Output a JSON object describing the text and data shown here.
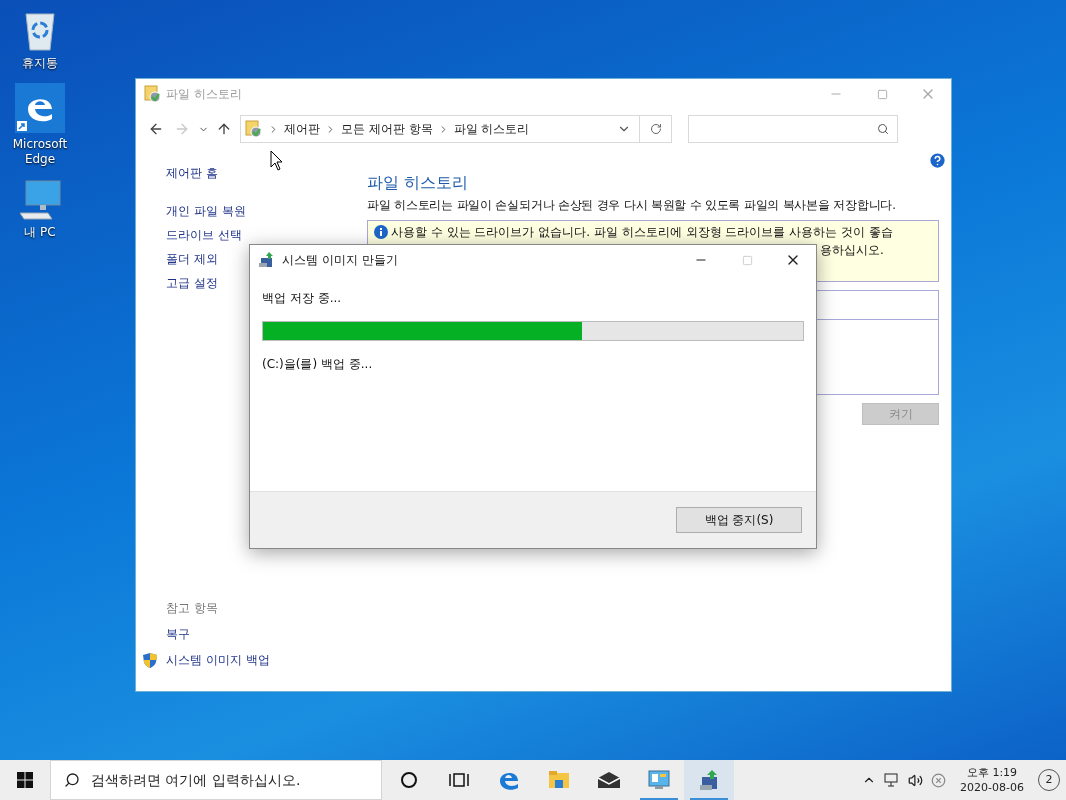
{
  "desktop_icons": [
    {
      "kind": "recycle",
      "label": "휴지통"
    },
    {
      "kind": "edge",
      "label": "Microsoft Edge"
    },
    {
      "kind": "pc",
      "label": "내 PC"
    }
  ],
  "window": {
    "title": "파일 히스토리",
    "nav_buttons": [
      {
        "kind": "back",
        "disabled": false
      },
      {
        "kind": "forward",
        "disabled": true
      },
      {
        "kind": "recent",
        "disabled": false
      },
      {
        "kind": "up",
        "disabled": false
      }
    ],
    "breadcrumb": [
      "제어판",
      "모든 제어판 항목",
      "파일 히스토리"
    ],
    "sidebar": {
      "links": [
        "제어판 홈",
        "개인 파일 복원",
        "드라이브 선택",
        "폴더 제외",
        "고급 설정"
      ],
      "see_also_heading": "참고 항목",
      "see_also": [
        {
          "kind": "plain",
          "label": "복구"
        },
        {
          "kind": "shield",
          "label": "시스템 이미지 백업"
        }
      ]
    },
    "heading": "파일 히스토리",
    "description": "파일 히스토리는 파일이 손실되거나 손상된 경우 다시 복원할 수 있도록 파일의 복사본을 저장합니다.",
    "info_line_1": "사용할 수 있는 드라이브가 없습니다. 파일 히스토리에 외장형 드라이브를 사용하는 것이 좋습",
    "info_line_2_visible": "용하십시오.",
    "turn_on_button": {
      "label": "켜기",
      "disabled": true
    }
  },
  "dialog": {
    "title": "시스템 이미지 만들기",
    "status": "백업 저장 중...",
    "progress": {
      "level": 0.59
    },
    "detail": "(C:)을(를) 백업 중...",
    "stop_button": "백업 중지(S)"
  },
  "taskbar": {
    "search_placeholder": "검색하려면 여기에 입력하십시오.",
    "apps": [
      {
        "kind": "cortana",
        "running": false,
        "selected": false
      },
      {
        "kind": "taskview",
        "running": false,
        "selected": false
      },
      {
        "kind": "edge",
        "running": false,
        "selected": false
      },
      {
        "kind": "explorer",
        "running": false,
        "selected": false
      },
      {
        "kind": "mail",
        "running": false,
        "selected": false
      },
      {
        "kind": "controlpanel",
        "running": true,
        "selected": false
      },
      {
        "kind": "backup",
        "running": true,
        "selected": true
      }
    ],
    "time": "오후 1:19",
    "date": "2020-08-06",
    "notification_count": "2"
  }
}
